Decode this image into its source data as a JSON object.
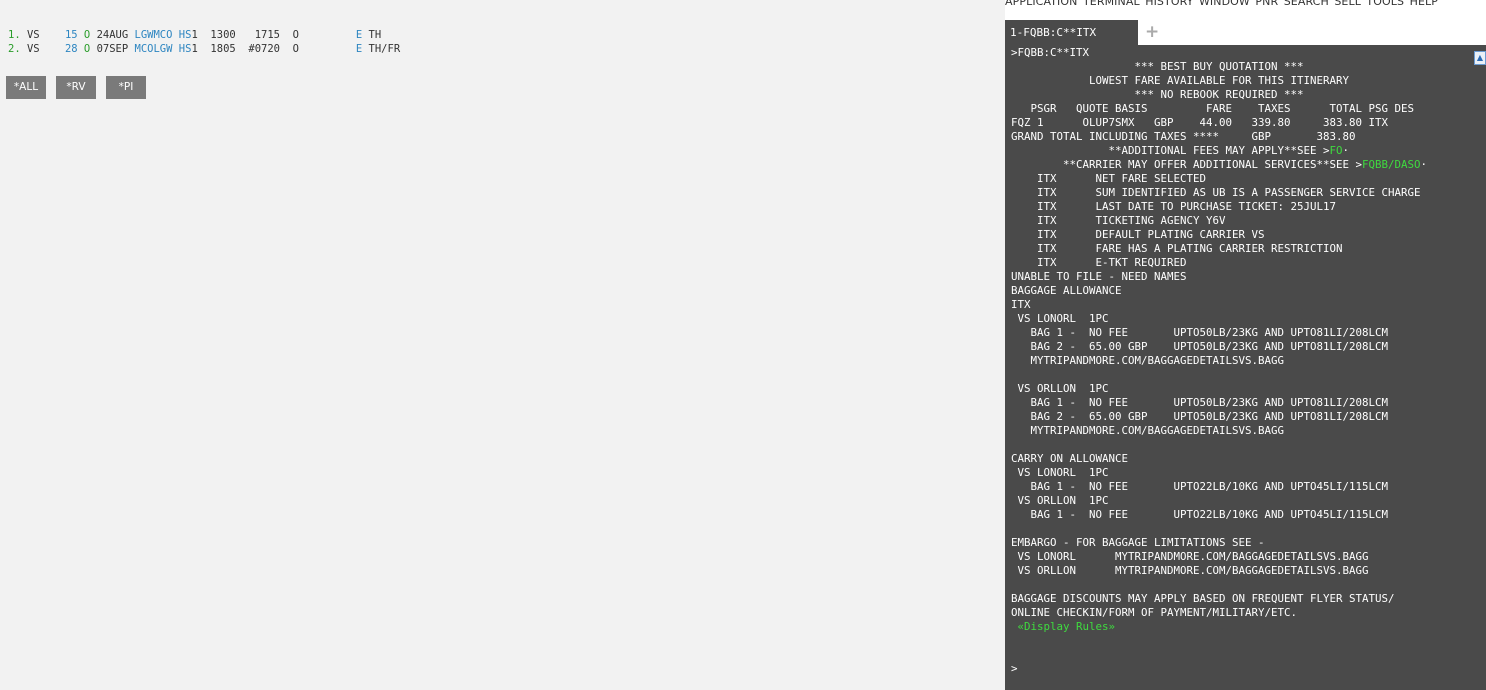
{
  "pnr": {
    "segments": [
      {
        "num": "1.",
        "carrier": "VS",
        "flight": "15",
        "class": "O",
        "date": "24AUG",
        "route": "LGWMCO",
        "status": "HS",
        "qty": "1",
        "dep": "1300",
        "arr": "1715",
        "extra": "",
        "cabin": "O",
        "eticket": "E",
        "days": "TH"
      },
      {
        "num": "2.",
        "carrier": "VS",
        "flight": "28",
        "class": "O",
        "date": "07SEP",
        "route": "MCOLGW",
        "status": "HS",
        "qty": "1",
        "dep": "1805",
        "arr": "",
        "extra": "#0720",
        "cabin": "O",
        "eticket": "E",
        "days": "TH/FR"
      }
    ],
    "buttons": {
      "all": "*ALL",
      "rv": "*RV",
      "pi": "*PI"
    }
  },
  "menu": [
    "APPLICATION",
    "TERMINAL",
    "HISTORY",
    "WINDOW",
    "PNR",
    "SEARCH",
    "SELL",
    "TOOLS",
    "HELP"
  ],
  "tabs": {
    "active": "1-FQBB:C**ITX",
    "add": "+"
  },
  "terminal": {
    "lines": [
      ">FQBB:C**ITX",
      "                   *** BEST BUY QUOTATION ***",
      "            LOWEST FARE AVAILABLE FOR THIS ITINERARY",
      "                   *** NO REBOOK REQUIRED ***",
      "   PSGR   QUOTE BASIS         FARE    TAXES      TOTAL PSG DES",
      "FQZ 1      OLUP7SMX   GBP    44.00   339.80     383.80 ITX",
      "GRAND TOTAL INCLUDING TAXES ****     GBP       383.80",
      "               **ADDITIONAL FEES MAY APPLY**SEE >",
      "        **CARRIER MAY OFFER ADDITIONAL SERVICES**SEE >",
      "    ITX      NET FARE SELECTED",
      "    ITX      SUM IDENTIFIED AS UB IS A PASSENGER SERVICE CHARGE",
      "    ITX      LAST DATE TO PURCHASE TICKET: 25JUL17",
      "    ITX      TICKETING AGENCY Y6V",
      "    ITX      DEFAULT PLATING CARRIER VS",
      "    ITX      FARE HAS A PLATING CARRIER RESTRICTION",
      "    ITX      E-TKT REQUIRED",
      "UNABLE TO FILE - NEED NAMES",
      "BAGGAGE ALLOWANCE",
      "ITX",
      " VS LONORL  1PC",
      "   BAG 1 -  NO FEE       UPTO50LB/23KG AND UPTO81LI/208LCM",
      "   BAG 2 -  65.00 GBP    UPTO50LB/23KG AND UPTO81LI/208LCM",
      "   MYTRIPANDMORE.COM/BAGGAGEDETAILSVS.BAGG",
      "",
      " VS ORLLON  1PC",
      "   BAG 1 -  NO FEE       UPTO50LB/23KG AND UPTO81LI/208LCM",
      "   BAG 2 -  65.00 GBP    UPTO50LB/23KG AND UPTO81LI/208LCM",
      "   MYTRIPANDMORE.COM/BAGGAGEDETAILSVS.BAGG",
      "",
      "CARRY ON ALLOWANCE",
      " VS LONORL  1PC",
      "   BAG 1 -  NO FEE       UPTO22LB/10KG AND UPTO45LI/115LCM",
      " VS ORLLON  1PC",
      "   BAG 1 -  NO FEE       UPTO22LB/10KG AND UPTO45LI/115LCM",
      "",
      "EMBARGO - FOR BAGGAGE LIMITATIONS SEE -",
      " VS LONORL      MYTRIPANDMORE.COM/BAGGAGEDETAILSVS.BAGG",
      " VS ORLLON      MYTRIPANDMORE.COM/BAGGAGEDETAILSVS.BAGG",
      "",
      "BAGGAGE DISCOUNTS MAY APPLY BASED ON FREQUENT FLYER STATUS/",
      "ONLINE CHECKIN/FORM OF PAYMENT/MILITARY/ETC.",
      "",
      "",
      "",
      ">"
    ],
    "link_fo": "FO",
    "link_daso": "FQBB/DASO",
    "dot": "·",
    "display_rules": " «Display Rules»"
  },
  "icons": {
    "scroll_up": "scroll-up-icon"
  }
}
